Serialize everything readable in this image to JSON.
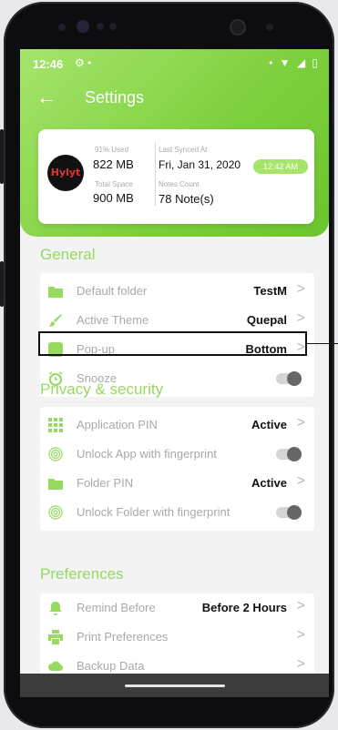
{
  "status_bar": {
    "time": "12:46",
    "left_icons": "⚙ •",
    "right_icons": "• ▼ ◢ ▯"
  },
  "header": {
    "title": "Settings",
    "back_icon": "arrow-left-icon"
  },
  "storage_card": {
    "used_label": "91% Used",
    "used_value": "822 MB",
    "total_label": "Total Space",
    "total_value": "900 MB",
    "sync_label": "Last Synced At",
    "sync_date": "Fri, Jan 31, 2020",
    "sync_time": "12:42 AM",
    "notes_label": "Notes Count",
    "notes_value": "78 Note(s)",
    "logo_text": "Hylyt"
  },
  "sections": {
    "general": "General",
    "privacy": "Privacy & security",
    "preferences": "Preferences"
  },
  "general_items": [
    {
      "label": "Default folder",
      "value": "TestM",
      "icon": "folder-icon"
    },
    {
      "label": "Active Theme",
      "value": "Quepal",
      "icon": "brush-icon"
    },
    {
      "label": "Pop-up",
      "value": "Bottom",
      "icon": "square-icon"
    },
    {
      "label": "Snooze",
      "value": "",
      "icon": "alarm-icon"
    }
  ],
  "privacy_items": [
    {
      "label": "Application PIN",
      "value": "Active",
      "icon": "keypad-icon"
    },
    {
      "label": "Unlock App with fingerprint",
      "value": "",
      "icon": "fingerprint-icon"
    },
    {
      "label": "Folder PIN",
      "value": "Active",
      "icon": "folder-icon"
    },
    {
      "label": "Unlock Folder with fingerprint",
      "value": "",
      "icon": "fingerprint-icon"
    }
  ],
  "preference_items": [
    {
      "label": "Remind Before",
      "value": "Before 2 Hours",
      "icon": "bell-icon"
    },
    {
      "label": "Print Preferences",
      "value": "",
      "icon": "printer-icon"
    },
    {
      "label": "Backup Data",
      "value": "",
      "icon": "cloud-icon"
    }
  ],
  "colors": {
    "accent": "#96da60",
    "header_gradient_start": "#a6e46c",
    "header_gradient_end": "#6cc52c"
  }
}
